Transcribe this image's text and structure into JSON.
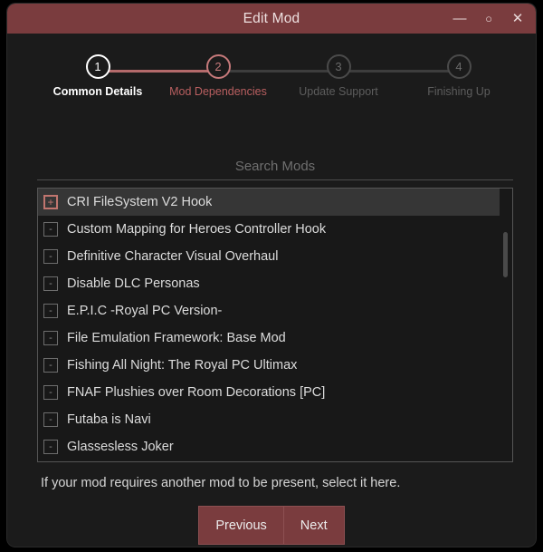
{
  "window": {
    "title": "Edit Mod",
    "controls": [
      {
        "name": "minimize",
        "glyph": "—"
      },
      {
        "name": "maximize",
        "glyph": "○"
      },
      {
        "name": "close",
        "glyph": "✕"
      }
    ]
  },
  "stepper": {
    "steps": [
      {
        "number": "1",
        "label": "Common Details",
        "state": "complete"
      },
      {
        "number": "2",
        "label": "Mod Dependencies",
        "state": "current"
      },
      {
        "number": "3",
        "label": "Update Support",
        "state": "pending"
      },
      {
        "number": "4",
        "label": "Finishing Up",
        "state": "pending"
      }
    ]
  },
  "search": {
    "placeholder": "Search Mods",
    "value": ""
  },
  "mod_list": {
    "items": [
      {
        "name": "CRI FileSystem V2 Hook",
        "selected": true,
        "glyph": "+"
      },
      {
        "name": "Custom Mapping for Heroes Controller Hook",
        "selected": false,
        "glyph": "-"
      },
      {
        "name": "Definitive Character Visual Overhaul",
        "selected": false,
        "glyph": "-"
      },
      {
        "name": "Disable DLC Personas",
        "selected": false,
        "glyph": "-"
      },
      {
        "name": "E.P.I.C -Royal PC Version-",
        "selected": false,
        "glyph": "-"
      },
      {
        "name": "File Emulation Framework: Base Mod",
        "selected": false,
        "glyph": "-"
      },
      {
        "name": "Fishing All Night: The Royal PC Ultimax",
        "selected": false,
        "glyph": "-"
      },
      {
        "name": "FNAF Plushies over Room Decorations [PC]",
        "selected": false,
        "glyph": "-"
      },
      {
        "name": "Futaba is Navi",
        "selected": false,
        "glyph": "-"
      },
      {
        "name": "Glassesless Joker",
        "selected": false,
        "glyph": "-"
      },
      {
        "name": "",
        "selected": false,
        "glyph": "-"
      }
    ]
  },
  "hint": "If your mod requires another mod to be present, select it here.",
  "buttons": {
    "previous": "Previous",
    "next": "Next"
  },
  "colors": {
    "accent": "#7a3c3e",
    "accent_light": "#c5797a",
    "window_bg": "#1b1b1b",
    "list_bg": "#181818",
    "selected_row": "#363636"
  }
}
